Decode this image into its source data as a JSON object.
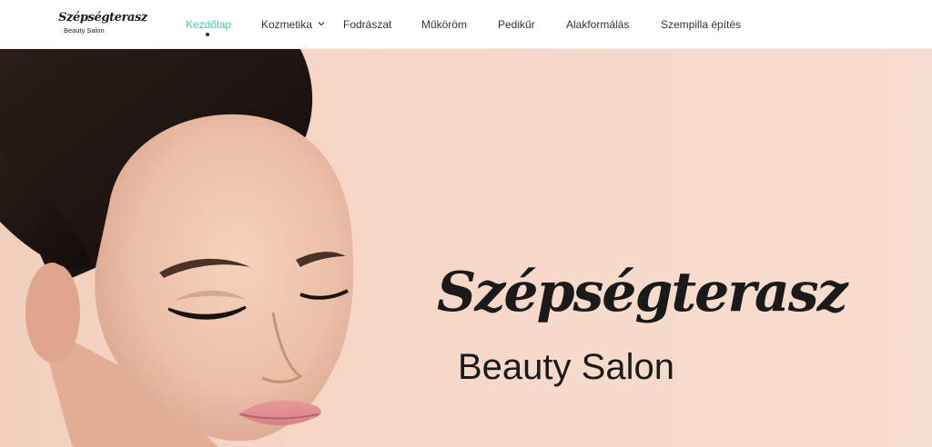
{
  "logo": {
    "script_text": "Szépségterasz",
    "sub_text": "Beauty Salon"
  },
  "nav": {
    "items": [
      {
        "label": "Kezdőlap",
        "active": true
      },
      {
        "label": "Kozmetika",
        "active": false,
        "has_dropdown": true
      },
      {
        "label": "Fodrászat",
        "active": false
      },
      {
        "label": "Műköröm",
        "active": false
      },
      {
        "label": "Pedikűr",
        "active": false
      },
      {
        "label": "Alakformálás",
        "active": false
      },
      {
        "label": "Szempilla építés",
        "active": false
      }
    ]
  },
  "hero": {
    "title": "Szépségterasz",
    "subtitle": "Beauty Salon"
  },
  "colors": {
    "accent": "#3ecfa6",
    "nav_text": "#333333",
    "hero_bg": "#f6d8c8",
    "title_text": "#1a1a1a"
  }
}
